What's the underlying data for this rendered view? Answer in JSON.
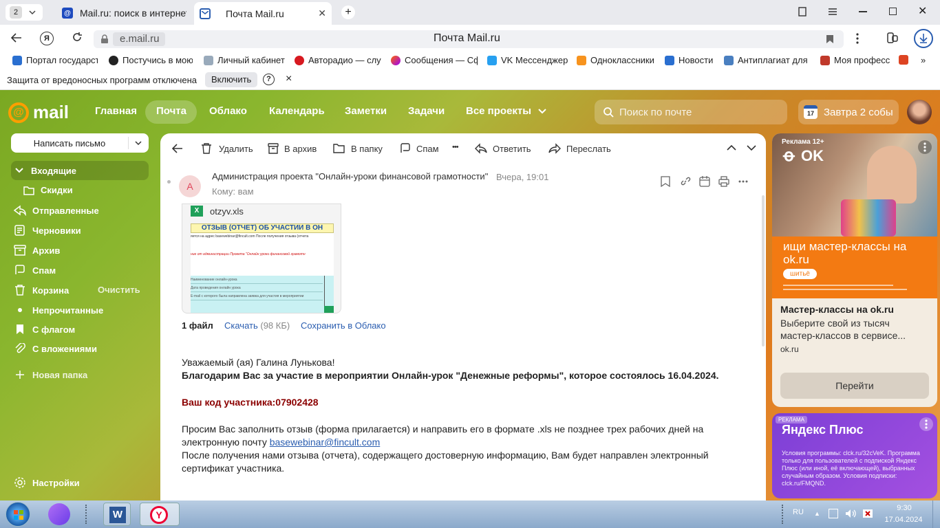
{
  "browser": {
    "tab_count": "2",
    "tabs": [
      {
        "title": "Mail.ru: поиск в интернете"
      },
      {
        "title": "Почта Mail.ru"
      }
    ],
    "url": "e.mail.ru",
    "page_title": "Почта Mail.ru",
    "bookmarks": [
      "Портал государст",
      "Постучись в мою",
      "Личный кабинет",
      "Авторадио — слу",
      "Сообщения — Сф",
      "VK Мессенджер",
      "Одноклассники",
      "Новости",
      "Антиплагиат для",
      "Моя професс"
    ],
    "warning": {
      "text": "Защита от вредоносных программ отключена",
      "button": "Включить",
      "help": "?",
      "close": "×"
    }
  },
  "mail": {
    "logo": "mail",
    "nav": [
      "Главная",
      "Почта",
      "Облако",
      "Календарь",
      "Заметки",
      "Задачи",
      "Все проекты"
    ],
    "search_placeholder": "Поиск по почте",
    "calendar": {
      "day": "17",
      "text": "Завтра 2 собы"
    },
    "compose": "Написать письмо",
    "folders": [
      {
        "label": "Входящие"
      },
      {
        "label": "Скидки"
      },
      {
        "label": "Отправленные"
      },
      {
        "label": "Черновики"
      },
      {
        "label": "Архив"
      },
      {
        "label": "Спам"
      },
      {
        "label": "Корзина",
        "action": "Очистить"
      },
      {
        "label": "Непрочитанные"
      },
      {
        "label": "С флагом"
      },
      {
        "label": "С вложениями"
      }
    ],
    "new_folder": "Новая папка",
    "settings": "Настройки"
  },
  "toolbar": {
    "delete": "Удалить",
    "archive": "В архив",
    "to_folder": "В папку",
    "spam": "Спам",
    "more": "•••",
    "reply": "Ответить",
    "forward": "Переслать"
  },
  "message": {
    "avatar_letter": "А",
    "sender": "Администрация проекта \"Онлайн-уроки финансовой грамотности\"",
    "date": "Вчера, 19:01",
    "to": "Кому: вам",
    "attachment": {
      "filename": "otzyv.xls",
      "preview_title": "ОТЗЫВ (ОТЧЕТ) ОБ УЧАСТИИ В ОН",
      "preview_line1": "яется на адрес basewebinar@fincult.com После получения отзыва (отчета",
      "preview_line2": "ние от администрации Проекта \"Онлайн уроки финансовой грамотн",
      "preview_row1": "Наименование онлайн-урока",
      "preview_row2": "Дата проведения онлайн урока",
      "preview_row3": "E-mail с которого была направлена заявка для участия в мероприятии",
      "count": "1 файл",
      "download": "Скачать",
      "size": "(98 КБ)",
      "save": "Сохранить в Облако"
    },
    "greeting": "Уважаемый (ая) Галина Лунькова!",
    "thanks": "Благодарим Вас за участие в мероприятии Онлайн-урок \"Денежные реформы\", которое состоялось 16.04.2024.",
    "code": "Ваш код участника:07902428",
    "p1_start": "Просим Вас заполнить отзыв (форма прилагается) и направить его в формате .xls не позднее трех рабочих дней на электронную почту",
    "email": "basewebinar@fincult.com",
    "p2": "После получения нами отзыва (отчета), содержащего достоверную информацию, Вам будет направлен электронный сертификат участника."
  },
  "ads": {
    "ad1": {
      "badge": "Реклама 12+",
      "brand": "OK",
      "headline": "ищи мастер-классы на ok.ru",
      "tag": "шитьё",
      "title": "Мастер-классы на ok.ru",
      "desc": "Выберите свой из тысяч мастер-классов в сервисе...",
      "domain": "ok.ru",
      "button": "Перейти"
    },
    "ad2": {
      "badge": "РЕКЛАМА",
      "brand": "Яндекс Плюс",
      "text": "Условия программы: clck.ru/32cVeK. Программа только для пользователей с подпиской Яндекс Плюс (или иной, её включающей), выбранных случайным образом. Условия подписки: clck.ru/FMQND."
    }
  },
  "taskbar": {
    "lang": "RU",
    "time": "9:30",
    "date": "17.04.2024"
  }
}
